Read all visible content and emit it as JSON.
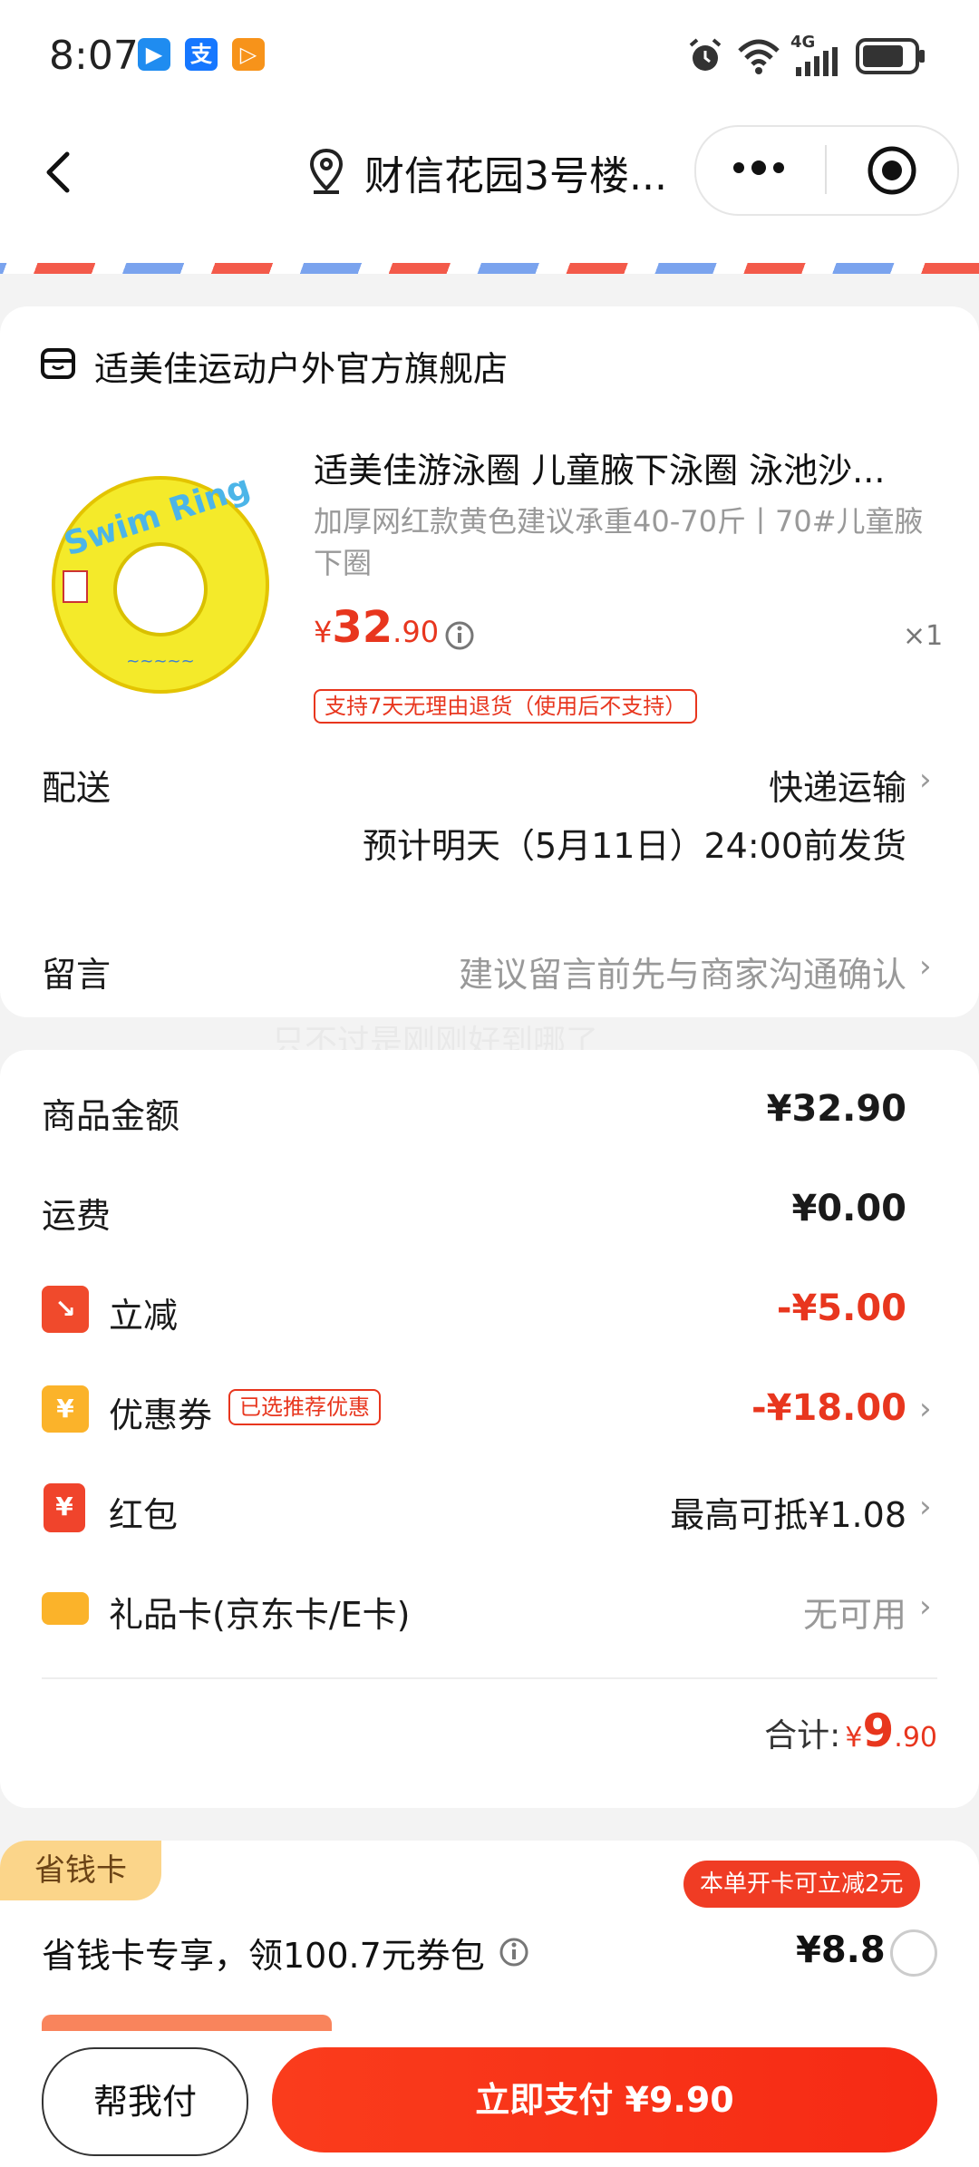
{
  "status_bar": {
    "time": "8:07",
    "apps": [
      {
        "name": "app-icon-1",
        "glyph": "▶",
        "color": "#1f8cf0"
      },
      {
        "name": "alipay-icon",
        "glyph": "支",
        "color": "#1677ff"
      },
      {
        "name": "app-icon-3",
        "glyph": "▷",
        "color": "#f7931a"
      }
    ],
    "network": "4G"
  },
  "nav": {
    "address": "财信花园3号楼..."
  },
  "store": {
    "name": "适美佳运动户外官方旗舰店",
    "product": {
      "title": "适美佳游泳圈 儿童腋下泳圈 泳池沙...",
      "spec": "加厚网红款黄色建议承重40-70斤丨70#儿童腋下圈",
      "price_symbol": "¥",
      "price_int": "32",
      "price_dec": ".90",
      "quantity": "×1",
      "return_tag": "支持7天无理由退货（使用后不支持）",
      "image_text": "Swim Ring"
    },
    "delivery": {
      "label": "配送",
      "method": "快递运输",
      "estimate": "预计明天（5月11日）24:00前发货"
    },
    "message": {
      "label": "留言",
      "placeholder": "建议留言前先与商家沟通确认"
    }
  },
  "watermark": "只不过是刚刚好到哪了",
  "price_summary": {
    "goods_label": "商品金额",
    "goods_value": "¥32.90",
    "shipping_label": "运费",
    "shipping_value": "¥0.00",
    "discount_label": "立减",
    "discount_value": "-¥5.00",
    "coupon_label": "优惠券",
    "coupon_tag": "已选推荐优惠",
    "coupon_value": "-¥18.00",
    "redpacket_label": "红包",
    "redpacket_value": "最高可抵¥1.08",
    "giftcard_label": "礼品卡(京东卡/E卡)",
    "giftcard_value": "无可用",
    "total_label": "合计:",
    "total_symbol": "¥",
    "total_int": "9",
    "total_dec": ".90"
  },
  "save_card": {
    "badge": "省钱卡",
    "desc": "省钱卡专享，领100.7元券包",
    "price": "¥8.8",
    "bubble": "本单开卡可立减2元"
  },
  "bottom_bar": {
    "help_pay": "帮我付",
    "pay_now": "立即支付 ¥9.90"
  },
  "colors": {
    "accent_red": "#e8361e",
    "pay_button": "#f62a14",
    "badge_yellow": "#fbd58a"
  }
}
